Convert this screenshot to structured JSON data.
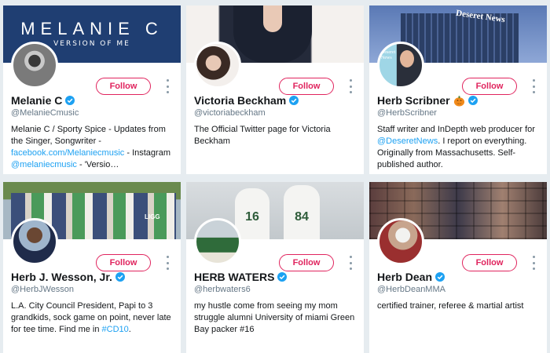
{
  "colors": {
    "page_bg": "#e6ecf0",
    "follow_accent": "#e0245e",
    "link": "#1da1f2",
    "verified": "#1da1f2"
  },
  "follow_label": "Follow",
  "cards": [
    {
      "name": "Melanie C",
      "handle": "@MelanieCmusic",
      "verified": true,
      "banner_text": "MELANIE C",
      "banner_subtext": "VERSION OF ME",
      "bio": [
        {
          "text": "Melanie C / Sporty Spice - Updates from the Singer, Songwriter - "
        },
        {
          "text": "facebook.com/Melaniecmusic",
          "link": true
        },
        {
          "text": " - Instagram "
        },
        {
          "text": "@melaniecmusic",
          "link": true
        },
        {
          "text": " - 'Versio…"
        }
      ]
    },
    {
      "name": "Victoria Beckham",
      "handle": "@victoriabeckham",
      "verified": true,
      "bio": [
        {
          "text": "The Official Twitter page for Victoria Beckham"
        }
      ]
    },
    {
      "name": "Herb Scribner",
      "handle": "@HerbScribner",
      "verified": true,
      "emoji": "pumpkin-icon",
      "banner_text": "Deseret News",
      "avatar_text": "Deseret News",
      "bio": [
        {
          "text": "Staff writer and InDepth web producer for "
        },
        {
          "text": "@DeseretNews",
          "link": true
        },
        {
          "text": ". I report on everything. Originally from Massachusetts. Self-published author."
        }
      ]
    },
    {
      "name": "Herb J. Wesson, Jr.",
      "handle": "@HerbJWesson",
      "verified": true,
      "banner_text": "LIGG",
      "bio": [
        {
          "text": "L.A. City Council President, Papi to 3 grandkids, sock game on point, never late for tee time. Find me in "
        },
        {
          "text": "#CD10",
          "link": true
        },
        {
          "text": "."
        }
      ]
    },
    {
      "name": "HERB WATERS",
      "handle": "@herbwaters6",
      "verified": true,
      "jersey_1": "16",
      "jersey_2": "84",
      "bio": [
        {
          "text": "my hustle come from seeing my mom struggle alumni University of miami Green Bay packer #16"
        }
      ]
    },
    {
      "name": "Herb Dean",
      "handle": "@HerbDeanMMA",
      "verified": true,
      "bio": [
        {
          "text": "certified trainer, referee & martial artist"
        }
      ]
    }
  ]
}
